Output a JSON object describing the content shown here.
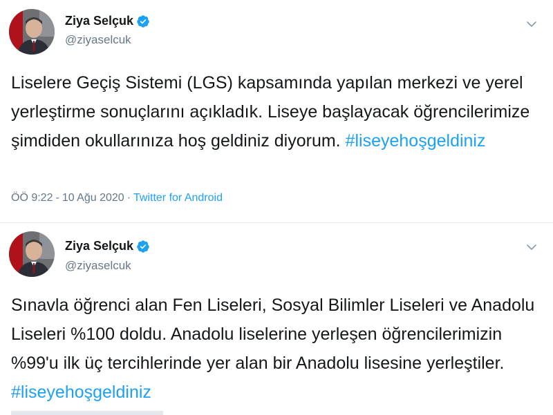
{
  "tweets": [
    {
      "author": {
        "name": "Ziya Selçuk",
        "handle": "@ziyaselcuk"
      },
      "text": "Liselere Geçiş Sistemi (LGS) kapsamında yapılan merkezi ve yerel yerleştirme sonuçlarını açıkladık. Liseye başlayacak öğrencilerimize şimdiden okullarınıza hoş geldiniz diyorum. ",
      "hashtag": "#liseyehoşgeldiniz",
      "time": "ÖÖ 9:22",
      "date": "10 Ağu 2020",
      "separator": "·",
      "source": "Twitter for Android"
    },
    {
      "author": {
        "name": "Ziya Selçuk",
        "handle": "@ziyaselcuk"
      },
      "text": "Sınavla öğrenci alan Fen Liseleri, Sosyal Bilimler Liseleri ve Anadolu Liseleri %100 doldu. Anadolu liselerine yerleşen öğrencilerimizin %99'u ilk üç tercihlerinde yer alan bir Anadolu lisesine yerleştiler. ",
      "hashtag": "#liseyehoşgeldiniz"
    }
  ],
  "icons": {
    "verified": "verified-badge-icon",
    "menu": "chevron-down-icon"
  },
  "colors": {
    "link": "#1da1f2",
    "text": "#14171a",
    "secondary": "#657786"
  }
}
